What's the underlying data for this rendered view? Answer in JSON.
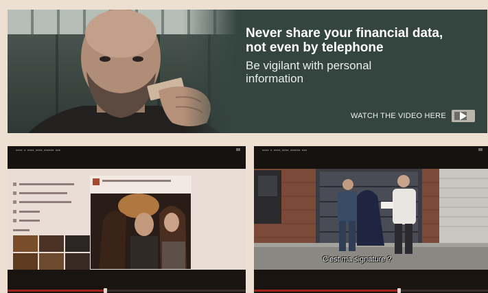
{
  "banner": {
    "headline_line1": "Never share your financial data,",
    "headline_line2": "not even by telephone",
    "subline_line1": "Be vigilant with personal",
    "subline_line2": "information",
    "watch_label": "WATCH THE VIDEO HERE"
  },
  "videos": [
    {
      "kind": "social-profile-screen",
      "progress": 0.41
    },
    {
      "kind": "street-scene",
      "subtitle": "C'est ma signature ?",
      "progress": 0.62
    }
  ],
  "colors": {
    "background": "#eedfd3",
    "banner": "#344540",
    "progress": "#9f1f1a"
  },
  "icons": {
    "play": "play-icon"
  }
}
